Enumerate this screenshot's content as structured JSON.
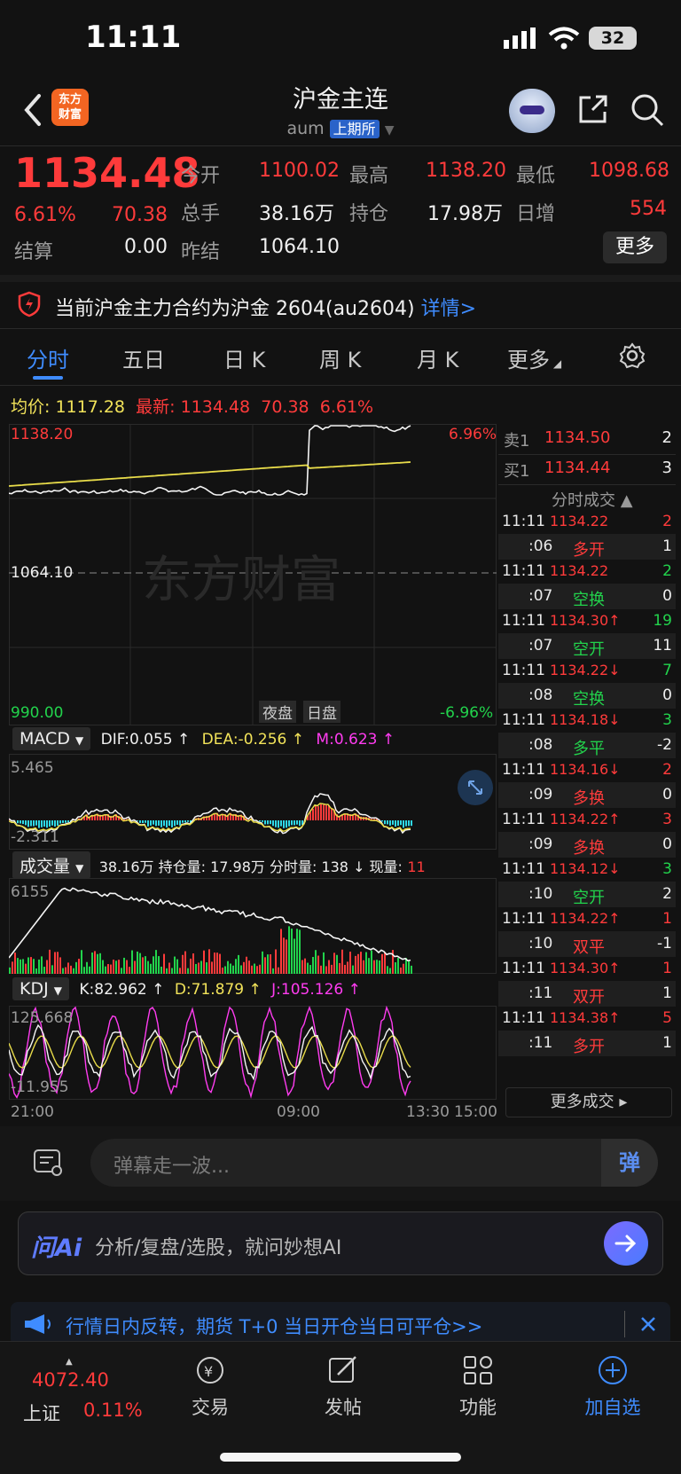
{
  "status_bar": {
    "time": "11:11",
    "battery": "32"
  },
  "header": {
    "logo_text": "东方\n财富",
    "title": "沪金主连",
    "code": "aum",
    "exchange": "上期所"
  },
  "quote": {
    "price": "1134.48",
    "change_pct": "6.61%",
    "change": "70.38",
    "open_label": "今开",
    "open": "1100.02",
    "high_label": "最高",
    "high": "1138.20",
    "low_label": "最低",
    "low": "1098.68",
    "volume_label": "总手",
    "volume": "38.16万",
    "oi_label": "持仓",
    "oi": "17.98万",
    "daily_inc_label": "日增",
    "daily_inc": "554",
    "settle_label": "结算",
    "settle": "0.00",
    "prev_settle_label": "昨结",
    "prev_settle": "1064.10",
    "more_label": "更多"
  },
  "notice": {
    "text": "当前沪金主力合约为沪金 2604(au2604)",
    "link": "详情>"
  },
  "tabs": [
    "分时",
    "五日",
    "日 K",
    "周 K",
    "月 K",
    "更多"
  ],
  "chart_header": {
    "avg_label": "均价:",
    "avg": "1117.28",
    "last_label": "最新:",
    "last": "1134.48",
    "change": "70.38",
    "pct": "6.61%"
  },
  "main_chart": {
    "y_top": "1138.20",
    "y_mid": "1064.10",
    "y_bottom": "990.00",
    "pct_top": "6.96%",
    "pct_bottom": "-6.96%",
    "session_night": "夜盘",
    "session_day": "日盘",
    "watermark": "东方财富",
    "x_labels": [
      "21:00",
      "09:00",
      "13:30",
      "15:00"
    ]
  },
  "macd": {
    "label": "MACD",
    "dif": "DIF:0.055 ↑",
    "dea": "DEA:-0.256 ↑",
    "m": "M:0.623 ↑",
    "y_top": "5.465",
    "y_bottom": "-2.311"
  },
  "volume_panel": {
    "label": "成交量",
    "summary": "38.16万 持仓量: 17.98万 分时量: 138 ↓ 现量:",
    "now": "11",
    "y_top": "6155"
  },
  "kdj": {
    "label": "KDJ",
    "k": "K:82.962 ↑",
    "d": "D:71.879 ↑",
    "j": "J:105.126 ↑",
    "y_top": "125.668",
    "y_bottom": "-11.955"
  },
  "order_book": {
    "ask_label": "卖1",
    "ask_price": "1134.50",
    "ask_vol": "2",
    "bid_label": "买1",
    "bid_price": "1134.44",
    "bid_vol": "3",
    "trades_title": "分时成交 ▲",
    "more_trades": "更多成交 ▸"
  },
  "trades": [
    {
      "time": "11:11",
      "price": "1134.22",
      "vol": "2",
      "pc": "red",
      "vc": "red"
    },
    {
      "time": ":06",
      "price": "多开",
      "vol": "1",
      "pc": "red",
      "vc": "white"
    },
    {
      "time": "11:11",
      "price": "1134.22",
      "vol": "2",
      "pc": "red",
      "vc": "green"
    },
    {
      "time": ":07",
      "price": "空换",
      "vol": "0",
      "pc": "green",
      "vc": "white"
    },
    {
      "time": "11:11",
      "price": "1134.30↑",
      "vol": "19",
      "pc": "red",
      "vc": "green"
    },
    {
      "time": ":07",
      "price": "空开",
      "vol": "11",
      "pc": "green",
      "vc": "white"
    },
    {
      "time": "11:11",
      "price": "1134.22↓",
      "vol": "7",
      "pc": "red",
      "vc": "green"
    },
    {
      "time": ":08",
      "price": "空换",
      "vol": "0",
      "pc": "green",
      "vc": "white"
    },
    {
      "time": "11:11",
      "price": "1134.18↓",
      "vol": "3",
      "pc": "red",
      "vc": "green"
    },
    {
      "time": ":08",
      "price": "多平",
      "vol": "-2",
      "pc": "green",
      "vc": "white"
    },
    {
      "time": "11:11",
      "price": "1134.16↓",
      "vol": "2",
      "pc": "red",
      "vc": "red"
    },
    {
      "time": ":09",
      "price": "多换",
      "vol": "0",
      "pc": "red",
      "vc": "white"
    },
    {
      "time": "11:11",
      "price": "1134.22↑",
      "vol": "3",
      "pc": "red",
      "vc": "red"
    },
    {
      "time": ":09",
      "price": "多换",
      "vol": "0",
      "pc": "red",
      "vc": "white"
    },
    {
      "time": "11:11",
      "price": "1134.12↓",
      "vol": "3",
      "pc": "red",
      "vc": "green"
    },
    {
      "time": ":10",
      "price": "空开",
      "vol": "2",
      "pc": "green",
      "vc": "white"
    },
    {
      "time": "11:11",
      "price": "1134.22↑",
      "vol": "1",
      "pc": "red",
      "vc": "red"
    },
    {
      "time": ":10",
      "price": "双平",
      "vol": "-1",
      "pc": "red",
      "vc": "white"
    },
    {
      "time": "11:11",
      "price": "1134.30↑",
      "vol": "1",
      "pc": "red",
      "vc": "red"
    },
    {
      "time": ":11",
      "price": "双开",
      "vol": "1",
      "pc": "red",
      "vc": "white"
    },
    {
      "time": "11:11",
      "price": "1134.38↑",
      "vol": "5",
      "pc": "red",
      "vc": "red"
    },
    {
      "time": ":11",
      "price": "多开",
      "vol": "1",
      "pc": "red",
      "vc": "white"
    }
  ],
  "danmu": {
    "placeholder": "弹幕走一波...",
    "send_label": "弹"
  },
  "ai_bar": {
    "brand": "问Ai",
    "prompt": "分析/复盘/选股，就问妙想AI"
  },
  "banner": {
    "text": "行情日内反转，期货 T+0 当日开仓当日可平仓>>"
  },
  "bottom_nav": {
    "index_value": "4072.40",
    "index_name": "上证",
    "index_pct": "0.11%",
    "items": [
      "交易",
      "发帖",
      "功能",
      "加自选"
    ]
  }
}
